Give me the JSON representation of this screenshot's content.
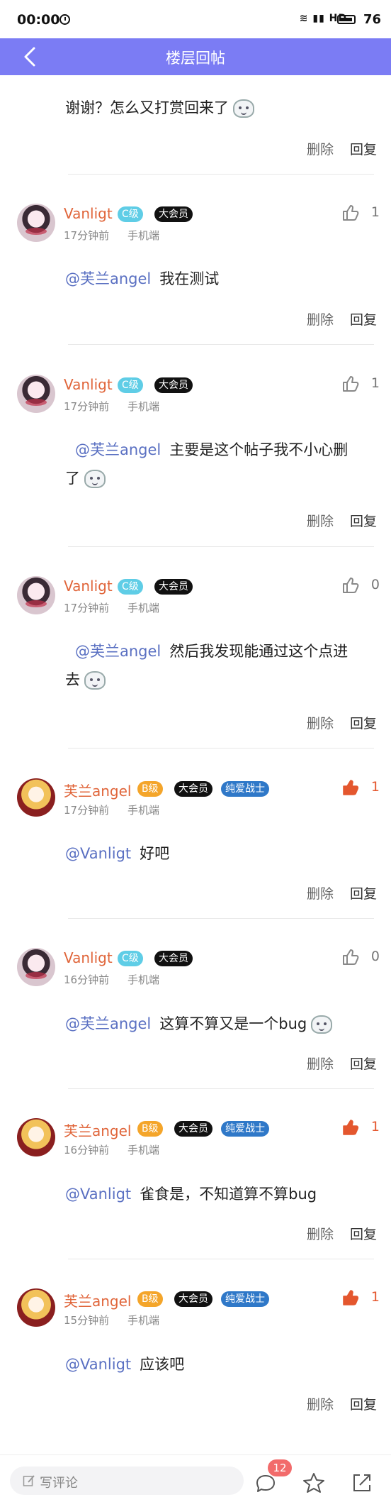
{
  "status": {
    "time": "00:00",
    "network": "HD",
    "battery": "76"
  },
  "header": {
    "title": "楼层回帖"
  },
  "first_reply": {
    "text": "谢谢？怎么又打赏回来了",
    "delete": "删除",
    "reply": "回复"
  },
  "comments": [
    {
      "name": "Vanligt",
      "level": "C级",
      "vip": "大会员",
      "time": "17分钟前",
      "device": "手机端",
      "likes": "1",
      "liked": false,
      "mention": "@芙兰angel",
      "text": "我在测试",
      "delete": "删除",
      "reply": "回复"
    },
    {
      "name": "Vanligt",
      "level": "C级",
      "vip": "大会员",
      "time": "17分钟前",
      "device": "手机端",
      "likes": "1",
      "liked": false,
      "mention": "@芙兰angel",
      "text": "主要是这个帖子我不小心删了",
      "delete": "删除",
      "reply": "回复"
    },
    {
      "name": "Vanligt",
      "level": "C级",
      "vip": "大会员",
      "time": "17分钟前",
      "device": "手机端",
      "likes": "0",
      "liked": false,
      "mention": "@芙兰angel",
      "text": "然后我发现能通过这个点进去",
      "delete": "删除",
      "reply": "回复"
    },
    {
      "name": "芙兰angel",
      "level": "B级",
      "vip": "大会员",
      "title_badge": "纯爱战士",
      "time": "17分钟前",
      "device": "手机端",
      "likes": "1",
      "liked": true,
      "mention": "@Vanligt",
      "text": "好吧",
      "delete": "删除",
      "reply": "回复"
    },
    {
      "name": "Vanligt",
      "level": "C级",
      "vip": "大会员",
      "time": "16分钟前",
      "device": "手机端",
      "likes": "0",
      "liked": false,
      "mention": "@芙兰angel",
      "text": "这算不算又是一个bug",
      "delete": "删除",
      "reply": "回复"
    },
    {
      "name": "芙兰angel",
      "level": "B级",
      "vip": "大会员",
      "title_badge": "纯爱战士",
      "time": "16分钟前",
      "device": "手机端",
      "likes": "1",
      "liked": true,
      "mention": "@Vanligt",
      "text": "雀食是，不知道算不算bug",
      "delete": "删除",
      "reply": "回复"
    },
    {
      "name": "芙兰angel",
      "level": "B级",
      "vip": "大会员",
      "title_badge": "纯爱战士",
      "time": "15分钟前",
      "device": "手机端",
      "likes": "1",
      "liked": true,
      "mention": "@Vanligt",
      "text": "应该吧",
      "delete": "删除",
      "reply": "回复"
    }
  ],
  "bottom": {
    "placeholder": "写评论",
    "comment_count": "12"
  },
  "icons": [
    "back-arrow-icon",
    "thumbs-up-icon",
    "sticker-icon",
    "pencil-icon",
    "comment-bubble-icon",
    "star-icon",
    "share-icon"
  ]
}
